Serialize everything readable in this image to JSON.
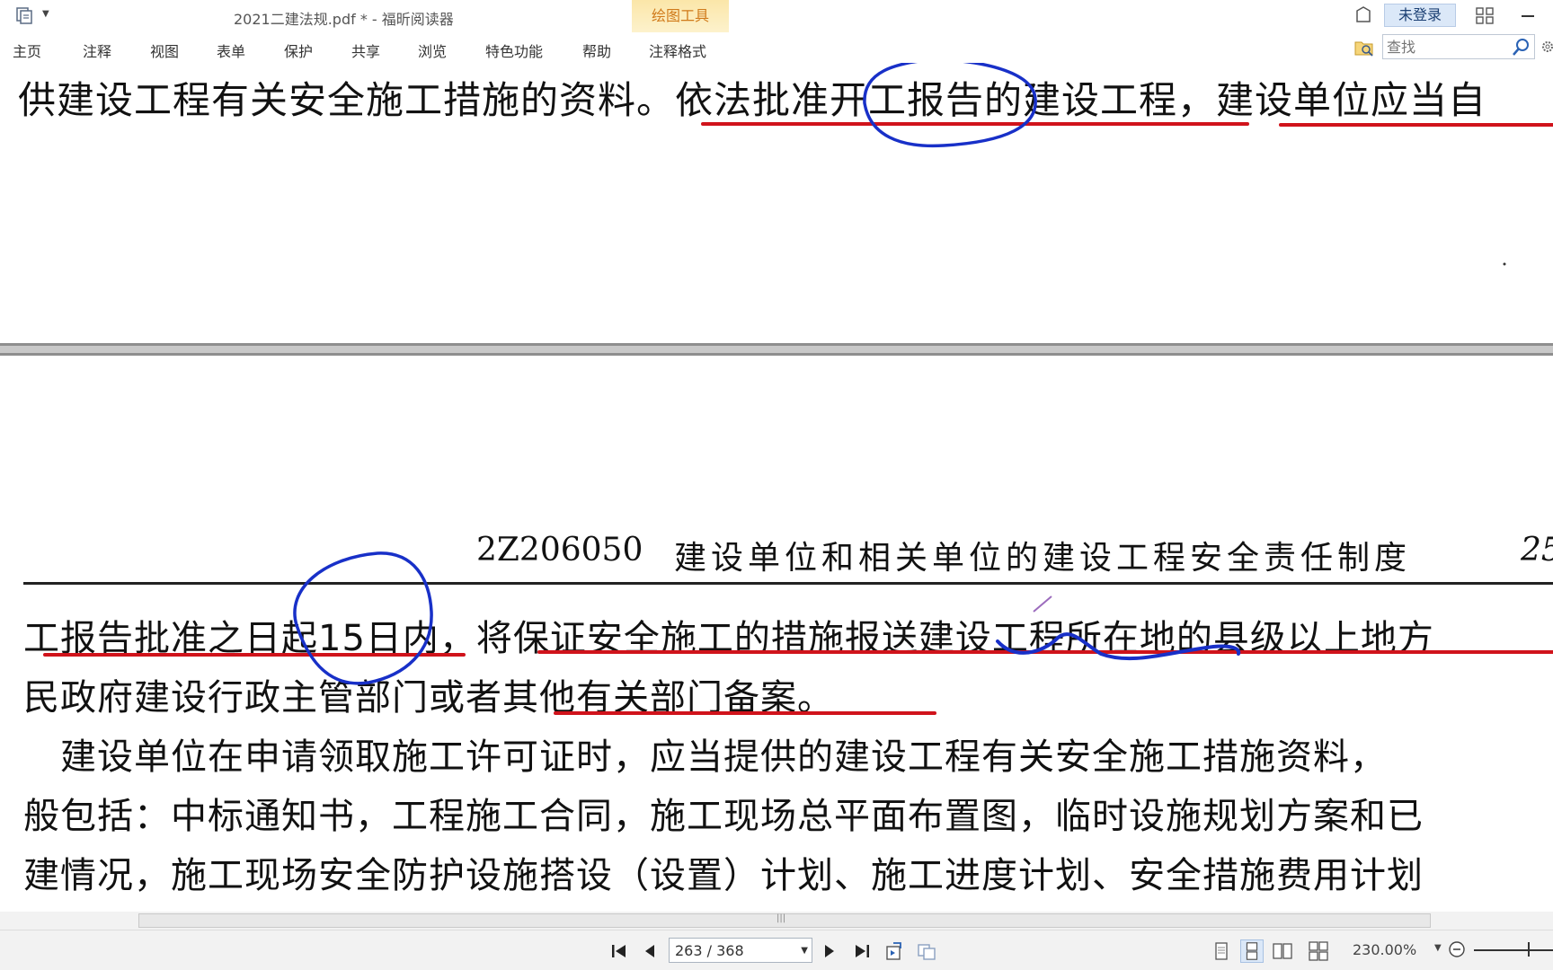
{
  "window": {
    "title": "2021二建法规.pdf * - 福昕阅读器",
    "contextual_tab": "绘图工具",
    "login_label": "未登录"
  },
  "menu": [
    {
      "label": "主页"
    },
    {
      "label": "注释"
    },
    {
      "label": "视图"
    },
    {
      "label": "表单"
    },
    {
      "label": "保护"
    },
    {
      "label": "共享"
    },
    {
      "label": "浏览"
    },
    {
      "label": "特色功能"
    },
    {
      "label": "帮助"
    },
    {
      "label": "注释格式"
    }
  ],
  "search": {
    "placeholder": "查找"
  },
  "document": {
    "top_line": "供建设工程有关安全施工措施的资料。依法批准开工报告的建设工程，建设单位应当自",
    "header": {
      "code": "2Z206050",
      "title": "建设单位和相关单位的建设工程安全责任制度",
      "page_num": "25"
    },
    "lines": [
      "工报告批准之日起15日内，将保证安全施工的措施报送建设工程所在地的县级以上地方",
      "民政府建设行政主管部门或者其他有关部门备案。",
      "　建设单位在申请领取施工许可证时，应当提供的建设工程有关安全施工措施资料，",
      "般包括：中标通知书，工程施工合同，施工现场总平面布置图，临时设施规划方案和已",
      "建情况，施工现场安全防护设施搭设（设置）计划、施工进度计划、安全措施费用计划"
    ],
    "annotation_colors": {
      "underline": "#d0131b",
      "ink": "#1830c8",
      "stray_mark": "#9b6bbd"
    }
  },
  "statusbar": {
    "page_indicator": "263 / 368",
    "zoom": "230.00%"
  }
}
